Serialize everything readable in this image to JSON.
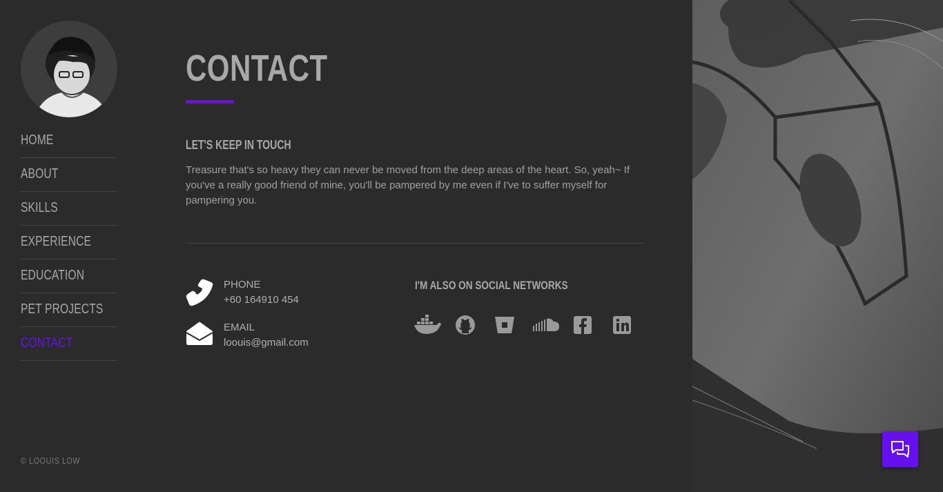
{
  "sidebar": {
    "nav": [
      {
        "label": "HOME"
      },
      {
        "label": "ABOUT"
      },
      {
        "label": "SKILLS"
      },
      {
        "label": "EXPERIENCE"
      },
      {
        "label": "EDUCATION"
      },
      {
        "label": "PET PROJECTS"
      },
      {
        "label": "CONTACT",
        "active": true
      }
    ],
    "copyright": "© LOOUIS LOW"
  },
  "main": {
    "title": "CONTACT",
    "subhead": "LET'S KEEP IN TOUCH",
    "intro": "Treasure that's so heavy they can never be moved from the deep areas of the heart. So, yeah~ If you've a really good friend of mine, you'll be pampered by me even if I've to suffer myself for pampering you.",
    "phone": {
      "label": "PHONE",
      "value": "+60 164910 454",
      "icon": "phone-icon"
    },
    "email": {
      "label": "EMAIL",
      "value": "loouis@gmail.com",
      "icon": "envelope-open-icon"
    },
    "social_heading": "I'M ALSO ON SOCIAL NETWORKS",
    "social": [
      "docker-icon",
      "github-icon",
      "bitbucket-icon",
      "soundcloud-icon",
      "facebook-icon",
      "linkedin-icon"
    ]
  },
  "colors": {
    "background": "#2b2b2b",
    "accent": "#6610f2",
    "text": "#a8a8a8"
  },
  "chat": {
    "icon": "chat-icon"
  }
}
